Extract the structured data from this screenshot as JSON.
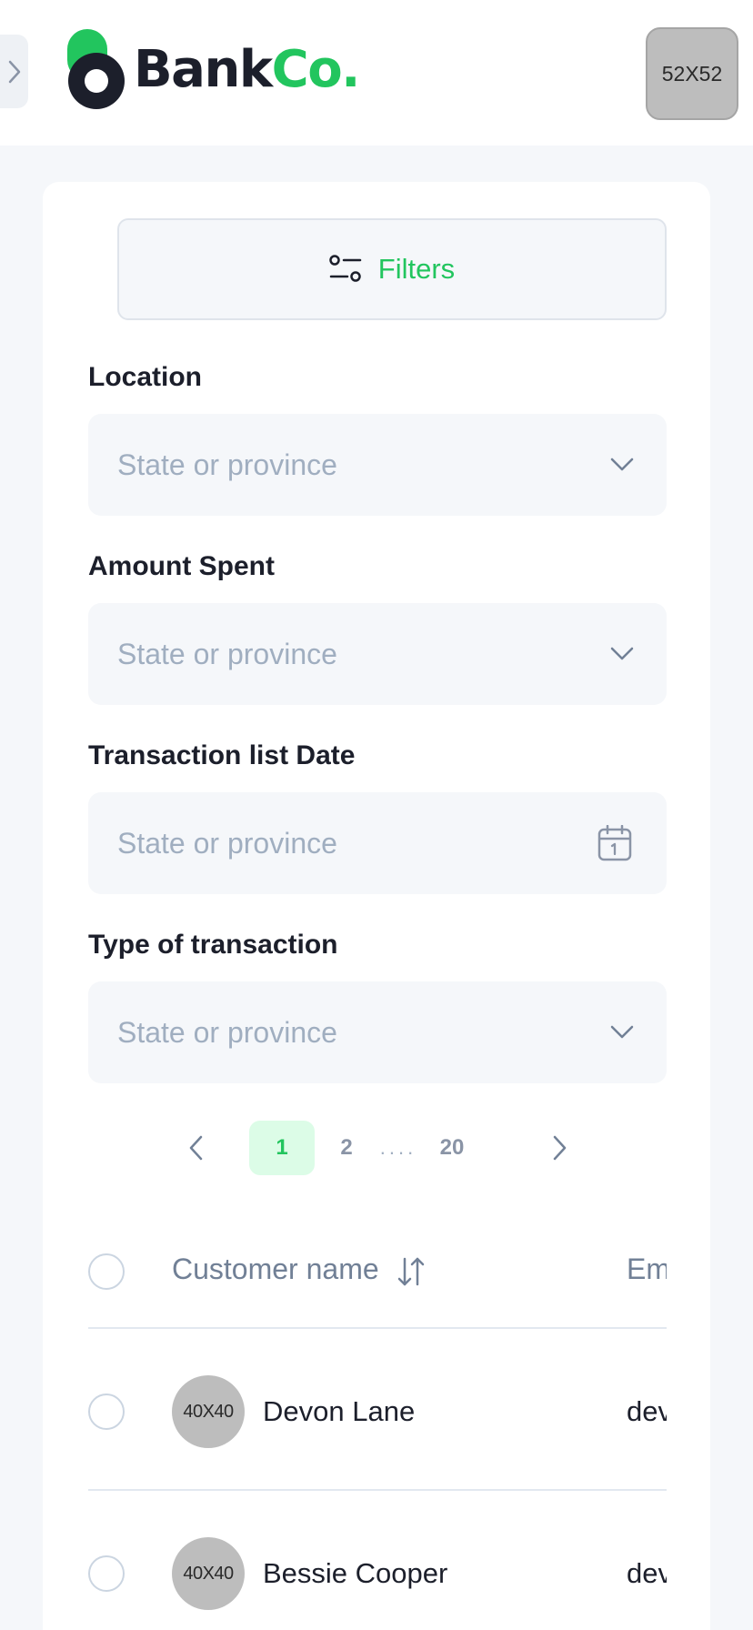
{
  "header": {
    "logo_primary": "Bank",
    "logo_accent": "Co.",
    "avatar_label": "52X52",
    "accent_color": "#22c55e"
  },
  "filters": {
    "button_label": "Filters",
    "fields": [
      {
        "label": "Location",
        "placeholder": "State or province",
        "icon": "chevron-down-icon"
      },
      {
        "label": "Amount Spent",
        "placeholder": "State or province",
        "icon": "chevron-down-icon"
      },
      {
        "label": "Transaction list Date",
        "placeholder": "State or province",
        "icon": "calendar-icon"
      },
      {
        "label": "Type of transaction",
        "placeholder": "State or province",
        "icon": "chevron-down-icon"
      }
    ]
  },
  "pagination": {
    "pages": [
      "1",
      "2",
      "....",
      "20"
    ],
    "active": "1"
  },
  "table": {
    "columns": [
      "Customer name",
      "Em"
    ],
    "rows": [
      {
        "avatar": "40X40",
        "name": "Devon Lane",
        "email": "dev"
      },
      {
        "avatar": "40X40",
        "name": "Bessie Cooper",
        "email": "dev"
      }
    ]
  }
}
